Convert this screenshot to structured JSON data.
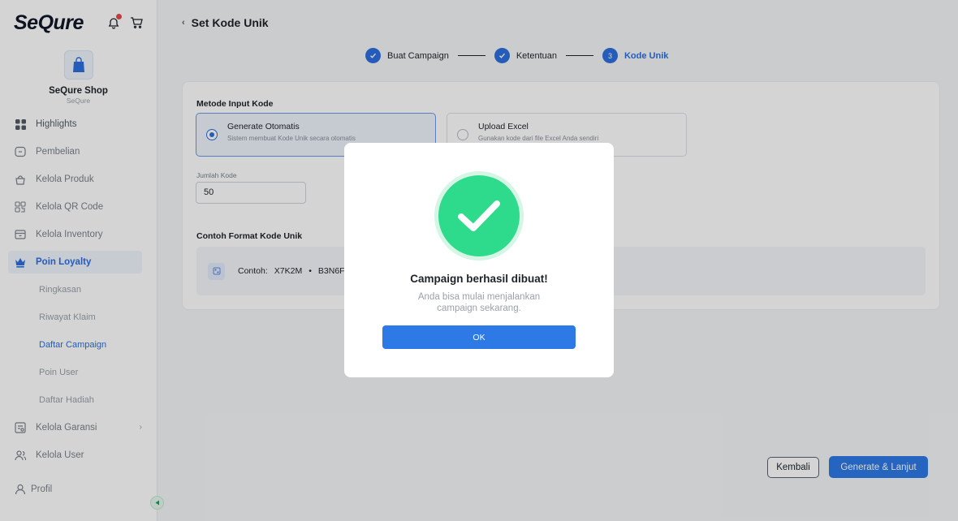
{
  "brand": {
    "logo": "SeQure",
    "notification_icon": "bell-icon",
    "cart_icon": "cart-icon"
  },
  "shop": {
    "name": "SeQure Shop",
    "subtitle": "SeQure"
  },
  "sidebar": {
    "items": [
      {
        "label": "Highlights",
        "icon": "grid-icon"
      },
      {
        "label": "Pembelian",
        "icon": "receipt-icon"
      },
      {
        "label": "Kelola Produk",
        "icon": "bag-icon"
      },
      {
        "label": "Kelola QR Code",
        "icon": "qr-icon"
      },
      {
        "label": "Kelola Inventory",
        "icon": "inventory-icon"
      },
      {
        "label": "Poin Loyalty",
        "icon": "crown-icon"
      },
      {
        "label": "Kelola Garansi",
        "icon": "warranty-icon"
      },
      {
        "label": "Kelola User",
        "icon": "users-icon"
      },
      {
        "label": "Profil",
        "icon": "user-icon"
      }
    ],
    "sub_items": [
      "Ringkasan",
      "Riwayat Klaim",
      "Daftar Campaign",
      "Poin User",
      "Daftar Hadiah"
    ],
    "active_item": "Poin Loyalty",
    "active_sub_item": "Daftar Campaign",
    "accent": "#2d6fe0"
  },
  "header": {
    "title": "Set Kode Unik"
  },
  "stepper": {
    "steps": [
      {
        "label": "Buat Campaign",
        "marker": ""
      },
      {
        "label": "Ketentuan",
        "marker": ""
      },
      {
        "label": "Kode Unik",
        "marker": "3"
      }
    ],
    "current_step": 3
  },
  "form": {
    "method_title": "Metode Input Kode",
    "options": [
      {
        "title": "Generate Otomatis",
        "desc": "Sistem membuat Kode Unik secara otomatis",
        "selected": true
      },
      {
        "title": "Upload Excel",
        "desc": "Gunakan kode dari file Excel Anda sendiri",
        "selected": false
      }
    ],
    "quantity_label": "Jumlah Kode",
    "quantity_value": "50",
    "format_title": "Contoh Format Kode Unik",
    "example_prefix": "Contoh:",
    "example_codes": [
      "X7K2M",
      "B3N6F"
    ]
  },
  "actions": {
    "back_label": "Kembali",
    "next_label": "Generate & Lanjut"
  },
  "modal": {
    "title": "Campaign berhasil dibuat!",
    "message": "Anda bisa mulai menjalankan campaign sekarang.",
    "ok_label": "OK",
    "success_color": "#2edb8c"
  }
}
